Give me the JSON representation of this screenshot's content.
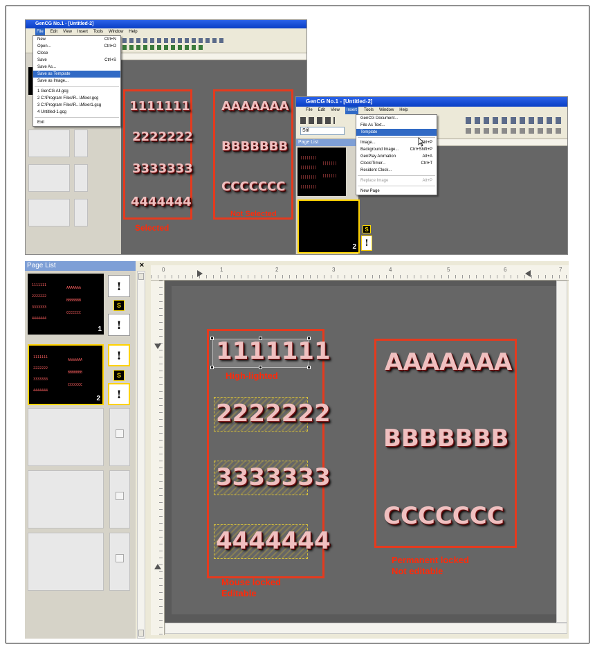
{
  "top_left": {
    "title": "GenCG No.1 - [Untitled-2]",
    "menus": [
      "File",
      "Edit",
      "View",
      "Insert",
      "Tools",
      "Window",
      "Help"
    ],
    "file_menu": [
      {
        "label": "New",
        "shortcut": "Ctrl+N"
      },
      {
        "label": "Open...",
        "shortcut": "Ctrl+O"
      },
      {
        "label": "Close",
        "shortcut": ""
      },
      {
        "label": "Save",
        "shortcut": "Ctrl+S"
      },
      {
        "label": "Save As...",
        "shortcut": ""
      },
      {
        "label": "Save as Template",
        "shortcut": "",
        "highlighted": true
      },
      {
        "label": "Save as Image...",
        "shortcut": ""
      },
      {
        "label": "1 GenCG All.gcg",
        "shortcut": ""
      },
      {
        "label": "2 C:\\Program Files\\R...\\Mixer.gcg",
        "shortcut": ""
      },
      {
        "label": "3 C:\\Program Files\\R...\\Mixer1.gcg",
        "shortcut": ""
      },
      {
        "label": "4 Untitled-1.gcg",
        "shortcut": ""
      },
      {
        "label": "Exit",
        "shortcut": ""
      }
    ],
    "left_values": [
      "1111111",
      "2222222",
      "3333333",
      "4444444"
    ],
    "right_values": [
      "AAAAAAA",
      "BBBBBBB",
      "CCCCCCC"
    ],
    "selected_caption": "Selected",
    "not_selected_caption": "Not Selected"
  },
  "top_right": {
    "title": "GenCG No.1 - [Untitled-2]",
    "menus": [
      "File",
      "Edit",
      "View",
      "Insert",
      "Tools",
      "Window",
      "Help"
    ],
    "style_select": "Stil",
    "page_list_label": "Page List",
    "insert_menu": [
      {
        "label": "GenCG Document...",
        "shortcut": ""
      },
      {
        "label": "File As Text...",
        "shortcut": ""
      },
      {
        "label": "Template",
        "shortcut": "",
        "highlighted": true
      },
      {
        "label": "Image...",
        "shortcut": "Ctrl+P"
      },
      {
        "label": "Background Image...",
        "shortcut": "Ctrl+Shift+P"
      },
      {
        "label": "GenPlay Animation",
        "shortcut": "Alt+A"
      },
      {
        "label": "Clock/Timer...",
        "shortcut": "Ctrl+T"
      },
      {
        "label": "Resident Clock...",
        "shortcut": ""
      },
      {
        "label": "Replace Image",
        "shortcut": "Alt+P",
        "disabled": true
      },
      {
        "label": "New Page",
        "shortcut": ""
      }
    ],
    "thumb_page_number": "2",
    "badge_s": "S"
  },
  "bottom": {
    "page_list_label": "Page List",
    "close_glyph": "×",
    "ruler_ticks": [
      "0",
      "1",
      "2",
      "3",
      "4",
      "5",
      "6",
      "7"
    ],
    "thumbs": [
      {
        "page": "1",
        "left": [
          "1111111",
          "2222222",
          "3333333",
          "4444444"
        ],
        "right": [
          "AAAAAAA",
          "BBBBBBB",
          "CCCCCCC"
        ]
      },
      {
        "page": "2",
        "left": [
          "1111111",
          "2222222",
          "3333333",
          "4444444"
        ],
        "right": [
          "AAAAAAA",
          "BBBBBBB",
          "CCCCCCC"
        ]
      }
    ],
    "side_mark": "!",
    "side_badge": "S",
    "left_values": [
      "1111111",
      "2222222",
      "3333333",
      "4444444"
    ],
    "right_values": [
      "AAAAAAA",
      "BBBBBBB",
      "CCCCCCC"
    ],
    "highlighted_caption": "High-lighted",
    "mouse_locked_caption_1": "Mouse locked",
    "mouse_locked_caption_2": "Editable",
    "perm_locked_caption_1": "Permanent locked",
    "perm_locked_caption_2": "Not editable"
  }
}
